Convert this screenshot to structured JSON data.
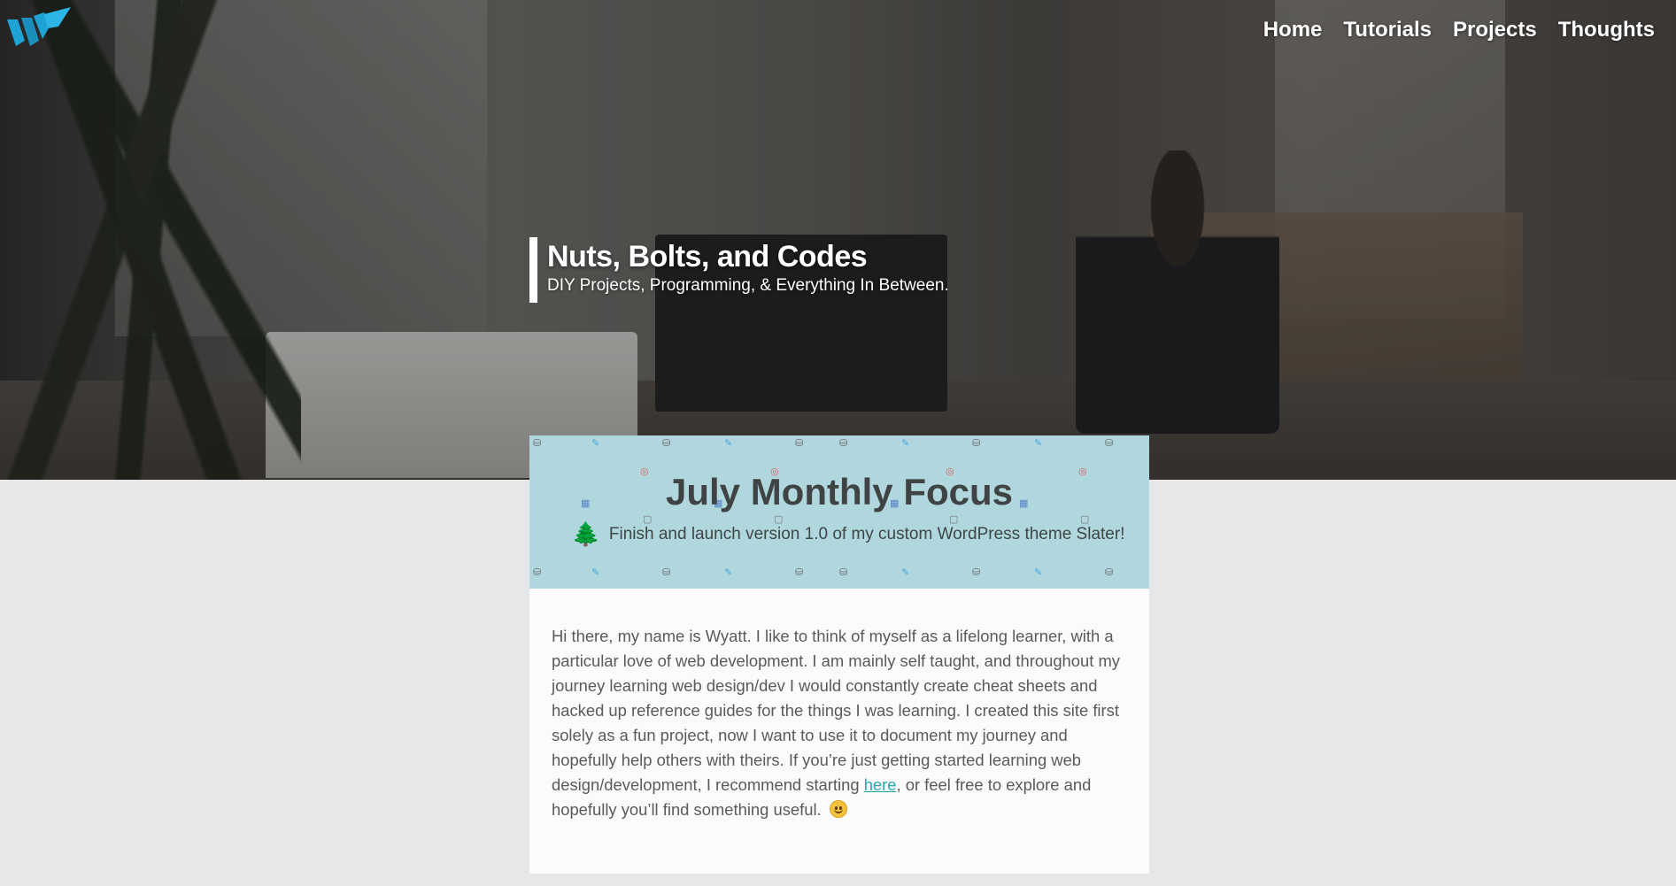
{
  "header": {
    "logo_letter": "W",
    "brand_color": "#1fa3d4",
    "nav": [
      {
        "label": "Home"
      },
      {
        "label": "Tutorials"
      },
      {
        "label": "Projects"
      },
      {
        "label": "Thoughts"
      }
    ]
  },
  "hero": {
    "title": "Nuts, Bolts, and Codes",
    "tagline": "DIY Projects, Programming, & Everything In Between."
  },
  "focus": {
    "title": "July Monthly Focus",
    "goal_icon": "tree-icon",
    "goal": "Finish and launch version 1.0 of my custom WordPress theme Slater!",
    "background_color": "#afd7dd"
  },
  "intro": {
    "text_before_link": "Hi there, my name is Wyatt. I like to think of myself as a lifelong learner, with a particular love of web development.  I am mainly self taught, and throughout my journey learning web design/dev I would constantly create cheat sheets and hacked up reference guides for the things I was learning. I created this site first solely as a fun project, now I want to use it to document my journey and hopefully help others with theirs. If you’re just getting started learning web design/development, I recommend starting ",
    "link_text": "here",
    "text_after_link": ", or feel free to explore and hopefully you’ll find something useful. ",
    "emoji": "smile-emoji",
    "link_color": "#27a8b8"
  }
}
